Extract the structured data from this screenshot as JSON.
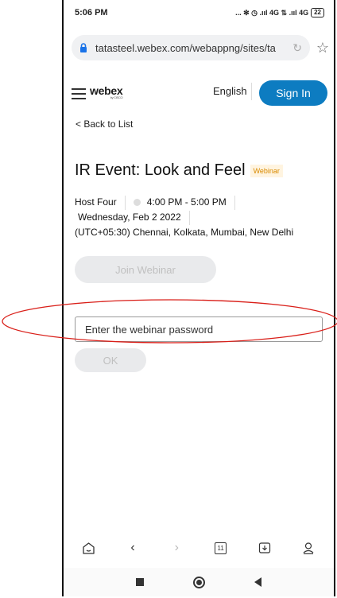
{
  "status_bar": {
    "time": "5:06 PM",
    "indicators": "... ✻ ◷ .ııl 4G ⇅ .ııl 4G",
    "battery": "22"
  },
  "browser": {
    "url": "tatasteel.webex.com/webappng/sites/ta",
    "icons": [
      "lock-icon",
      "reload-icon",
      "star-icon"
    ]
  },
  "header": {
    "logo": "webex",
    "logo_sub": "by CISCO",
    "language": "English",
    "sign_in": "Sign In",
    "brand_color": "#0d7cc1"
  },
  "back_link": "< Back to List",
  "event": {
    "title": "IR Event: Look and Feel",
    "badge": "Webinar",
    "host": "Host Four",
    "time": "4:00 PM - 5:00 PM",
    "date": "Wednesday, Feb 2 2022",
    "timezone": "(UTC+05:30) Chennai, Kolkata, Mumbai, New Delhi"
  },
  "join_button": "Join Webinar",
  "password": {
    "placeholder": "Enter the webinar password",
    "value": ""
  },
  "ok_button": "OK",
  "toolbar": {
    "tab_count": "11",
    "icons": [
      "home-icon",
      "back-icon",
      "forward-icon",
      "tabs-icon",
      "download-icon",
      "profile-icon"
    ]
  },
  "nav_icons": [
    "recents-icon",
    "home-button-icon",
    "back-nav-icon"
  ]
}
